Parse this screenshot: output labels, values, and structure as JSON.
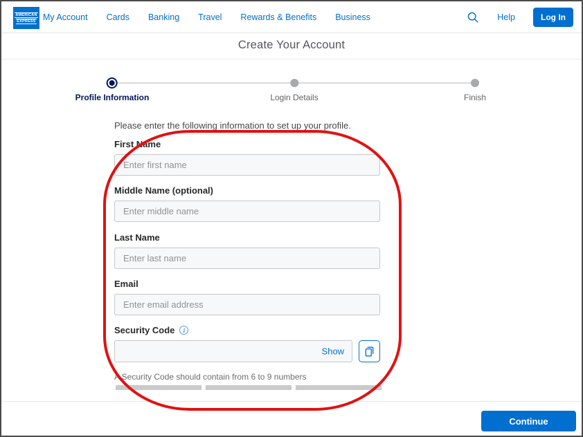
{
  "brand": {
    "logo_line1": "AMERICAN",
    "logo_line2": "EXPRESS"
  },
  "nav": {
    "items": [
      "My Account",
      "Cards",
      "Banking",
      "Travel",
      "Rewards & Benefits",
      "Business"
    ],
    "help_label": "Help",
    "login_label": "Log In"
  },
  "page": {
    "title": "Create Your Account"
  },
  "stepper": {
    "steps": [
      {
        "label": "Profile Information",
        "state": "active"
      },
      {
        "label": "Login Details",
        "state": "upcoming"
      },
      {
        "label": "Finish",
        "state": "upcoming"
      }
    ]
  },
  "form": {
    "instruction": "Please enter the following information to set up your profile.",
    "fields": [
      {
        "label": "First Name",
        "placeholder": "Enter first name",
        "value": ""
      },
      {
        "label": "Middle Name (optional)",
        "placeholder": "Enter middle name",
        "value": ""
      },
      {
        "label": "Last Name",
        "placeholder": "Enter last name",
        "value": ""
      },
      {
        "label": "Email",
        "placeholder": "Enter email address",
        "value": ""
      }
    ],
    "security": {
      "label": "Security Code",
      "info_icon_glyph": "i",
      "show_label": "Show",
      "value": "",
      "helper": "A Security Code should contain from 6 to 9 numbers",
      "strength_segments": 3
    }
  },
  "footer": {
    "continue_label": "Continue"
  },
  "colors": {
    "brand_blue": "#006fcf",
    "stepper_active_navy": "#00175a",
    "annotation_red": "#e01212",
    "input_background": "#f7f8f9",
    "strength_bar_gray": "#c9cacc"
  }
}
